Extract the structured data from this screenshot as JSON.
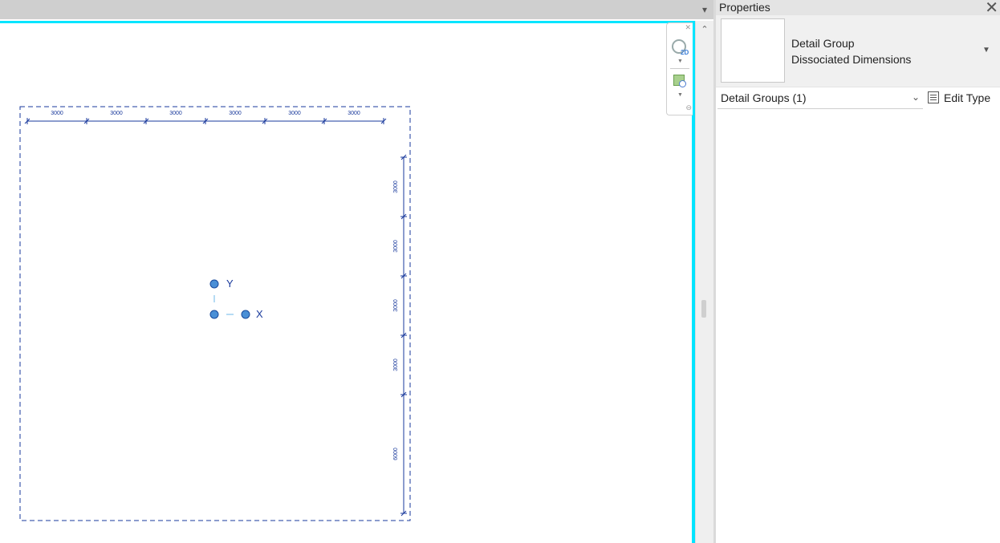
{
  "top_bar": {
    "menu_icon": "collapse-icon"
  },
  "canvas": {
    "accent_color": "#00e5ff",
    "line_color": "#1a3a9c",
    "top_dimensions": [
      "3000",
      "3000",
      "3000",
      "3000",
      "3000",
      "3000"
    ],
    "right_dimensions": [
      "3000",
      "3000",
      "3000",
      "3000",
      "6000"
    ],
    "origin": {
      "x_label": "X",
      "y_label": "Y"
    }
  },
  "nav_bar": {
    "wheel_label": "2D",
    "icons": [
      "steering-wheel-icon",
      "zoom-region-icon"
    ]
  },
  "properties": {
    "title": "Properties",
    "type_family": "Detail Group",
    "type_name": "Dissociated Dimensions",
    "filter": "Detail Groups (1)",
    "edit_type_label": "Edit Type"
  }
}
